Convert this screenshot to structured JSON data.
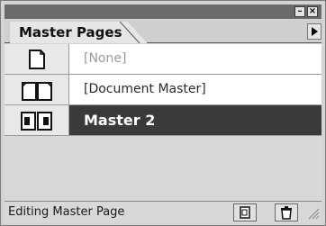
{
  "panel": {
    "title_buttons": {
      "minimize": "–",
      "close": "×"
    },
    "tab_label": "Master Pages",
    "menu_icon": "triangle-right-icon"
  },
  "masters": [
    {
      "label": "[None]",
      "icon": "single-page-icon",
      "selected": false
    },
    {
      "label": "[Document Master]",
      "icon": "spread-page-icon",
      "selected": false
    },
    {
      "label": "Master 2",
      "icon": "spread-page-icon",
      "selected": true
    }
  ],
  "status": {
    "text": "Editing Master Page",
    "new_icon": "new-page-icon",
    "delete_icon": "trash-icon"
  },
  "colors": {
    "selected_row": "#3a3a3a",
    "title_bar": "#6b6b6b"
  }
}
